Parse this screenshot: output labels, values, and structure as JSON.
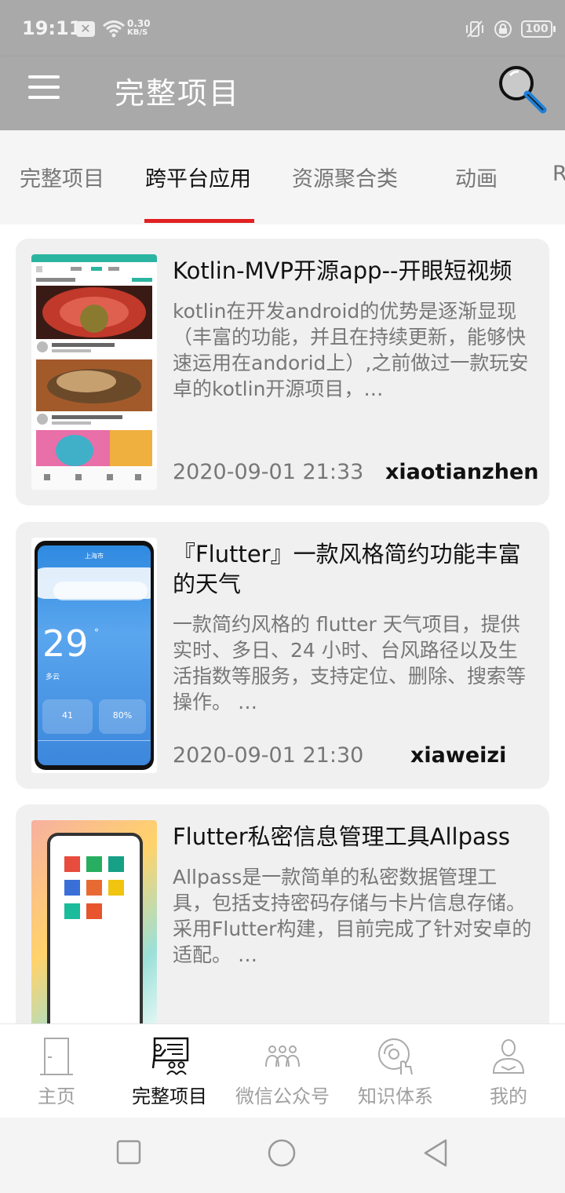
{
  "status_bar": {
    "time": "19:11",
    "speed": "0.30",
    "speed_unit": "KB/S",
    "battery": "100"
  },
  "app_bar": {
    "title": "完整项目",
    "menu_icon": "menu-icon",
    "search_icon": "search-icon"
  },
  "tabs": [
    {
      "label": "完整项目",
      "active": false
    },
    {
      "label": "跨平台应用",
      "active": true
    },
    {
      "label": "资源聚合类",
      "active": false
    },
    {
      "label": "动画",
      "active": false
    },
    {
      "label": "R",
      "active": false
    }
  ],
  "cards": [
    {
      "title": "Kotlin-MVP开源app--开眼短视频",
      "desc": "kotlin在开发android的优势是逐渐显现（丰富的功能，并且在持续更新，能够快速运用在andorid上）,之前做过一款玩安卓的kotlin开源项目，…",
      "date": "2020-09-01 21:33",
      "author": "xiaotianzhen"
    },
    {
      "title": "『Flutter』一款风格简约功能丰富的天气",
      "desc": "一款简约风格的 flutter 天气项目，提供实时、多日、24 小时、台风路径以及生活指数等服务，支持定位、删除、搜索等操作。 …",
      "date": "2020-09-01 21:30",
      "author": "xiaweizi",
      "thumb_city": "上海市",
      "thumb_temp": "29",
      "thumb_weather": "多云",
      "thumb_aqi": "41",
      "thumb_humidity": "80%"
    },
    {
      "title": "Flutter私密信息管理工具Allpass",
      "desc": "Allpass是一款简单的私密数据管理工具，包括支持密码存储与卡片信息存储。采用Flutter构建，目前完成了针对安卓的适配。 …",
      "date": "",
      "author": ""
    }
  ],
  "bottom_nav": [
    {
      "label": "主页",
      "icon": "door-icon",
      "active": false
    },
    {
      "label": "完整项目",
      "icon": "presentation-icon",
      "active": true
    },
    {
      "label": "微信公众号",
      "icon": "group-icon",
      "active": false
    },
    {
      "label": "知识体系",
      "icon": "disc-icon",
      "active": false
    },
    {
      "label": "我的",
      "icon": "person-icon",
      "active": false
    }
  ],
  "colors": {
    "bar": "#a9a9a9",
    "accent": "#e02020",
    "card_bg": "#f0f0f0"
  }
}
